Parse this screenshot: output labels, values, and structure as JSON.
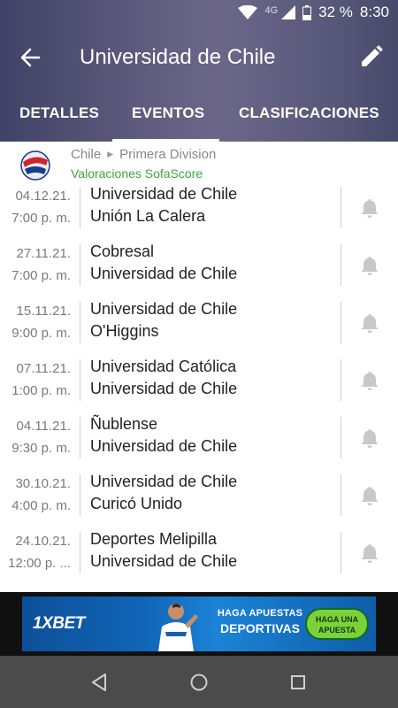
{
  "status_bar": {
    "network": "4G",
    "battery": "32 %",
    "time": "8:30"
  },
  "header": {
    "title": "Universidad de Chile"
  },
  "tabs": [
    {
      "label": "DETALLES",
      "active": false
    },
    {
      "label": "EVENTOS",
      "active": true
    },
    {
      "label": "CLASIFICACIONES",
      "active": false
    }
  ],
  "league": {
    "country": "Chile",
    "competition": "Primera Division",
    "ratings_link": "Valoraciones SofaScore"
  },
  "events": [
    {
      "date": "04.12.21.",
      "time": "7:00 p. m.",
      "home": "Universidad de Chile",
      "away": "Unión La Calera"
    },
    {
      "date": "27.11.21.",
      "time": "7:00 p. m.",
      "home": "Cobresal",
      "away": "Universidad de Chile"
    },
    {
      "date": "15.11.21.",
      "time": "9:00 p. m.",
      "home": "Universidad de Chile",
      "away": "O'Higgins"
    },
    {
      "date": "07.11.21.",
      "time": "1:00 p. m.",
      "home": "Universidad Católica",
      "away": "Universidad de Chile"
    },
    {
      "date": "04.11.21.",
      "time": "9:30 p. m.",
      "home": "Ñublense",
      "away": "Universidad de Chile"
    },
    {
      "date": "30.10.21.",
      "time": "4:00 p. m.",
      "home": "Universidad de Chile",
      "away": "Curicó Unido"
    },
    {
      "date": "24.10.21.",
      "time": "12:00 p. ...",
      "home": "Deportes Melipilla",
      "away": "Universidad de Chile"
    }
  ],
  "ad": {
    "brand": "1XBET",
    "tagline_line1": "HAGA APUESTAS",
    "tagline_line2": "DEPORTIVAS",
    "cta": "HAGA UNA APUESTA"
  },
  "colors": {
    "accent_green": "#3ca63c",
    "header_bg": "#5a587a",
    "nav_bg": "#4b4b4b"
  }
}
